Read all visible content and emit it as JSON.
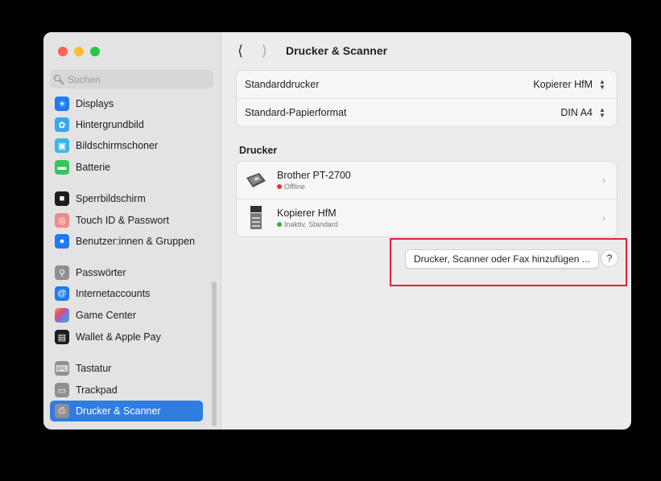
{
  "window": {
    "sidebar": {
      "search_placeholder": "Suchen",
      "items": [
        {
          "label": "Displays",
          "icon": "displays-icon",
          "color": "#1e7bf0"
        },
        {
          "label": "Hintergrundbild",
          "icon": "wallpaper-icon",
          "color": "#35a8f2"
        },
        {
          "label": "Bildschirmschoner",
          "icon": "screensaver-icon",
          "color": "#39b6e6"
        },
        {
          "label": "Batterie",
          "icon": "battery-icon",
          "color": "#34c759"
        },
        {
          "label": "Sperrbildschirm",
          "icon": "lock-screen-icon",
          "color": "#1c1c1e"
        },
        {
          "label": "Touch ID & Passwort",
          "icon": "fingerprint-icon",
          "color": "#f08a8a"
        },
        {
          "label": "Benutzer:innen & Gruppen",
          "icon": "users-icon",
          "color": "#1e7bf0"
        },
        {
          "label": "Passwörter",
          "icon": "key-icon",
          "color": "#8e8e93"
        },
        {
          "label": "Internetaccounts",
          "icon": "at-icon",
          "color": "#1e7bf0"
        },
        {
          "label": "Game Center",
          "icon": "game-center-icon",
          "color": "#f2a33a"
        },
        {
          "label": "Wallet & Apple Pay",
          "icon": "wallet-icon",
          "color": "#1c1c1e"
        },
        {
          "label": "Tastatur",
          "icon": "keyboard-icon",
          "color": "#8e8e93"
        },
        {
          "label": "Trackpad",
          "icon": "trackpad-icon",
          "color": "#8e8e93"
        },
        {
          "label": "Drucker & Scanner",
          "icon": "printer-icon",
          "color": "#8e8e93"
        }
      ]
    },
    "content": {
      "title": "Drucker & Scanner",
      "defaults": {
        "printer_label": "Standarddrucker",
        "printer_value": "Kopierer HfM",
        "paper_label": "Standard-Papierformat",
        "paper_value": "DIN A4"
      },
      "printers_section": "Drucker",
      "printers": [
        {
          "name": "Brother PT-2700",
          "status": "Offline",
          "status_color": "#e0303a",
          "icon": "label-printer-icon"
        },
        {
          "name": "Kopierer HfM",
          "status": "Inaktiv, Standard",
          "status_color": "#2fb34a",
          "icon": "copier-icon"
        }
      ],
      "add_button": "Drucker, Scanner oder Fax hinzufügen ...",
      "help_button": "?"
    },
    "highlight_color": "#e0203a"
  }
}
